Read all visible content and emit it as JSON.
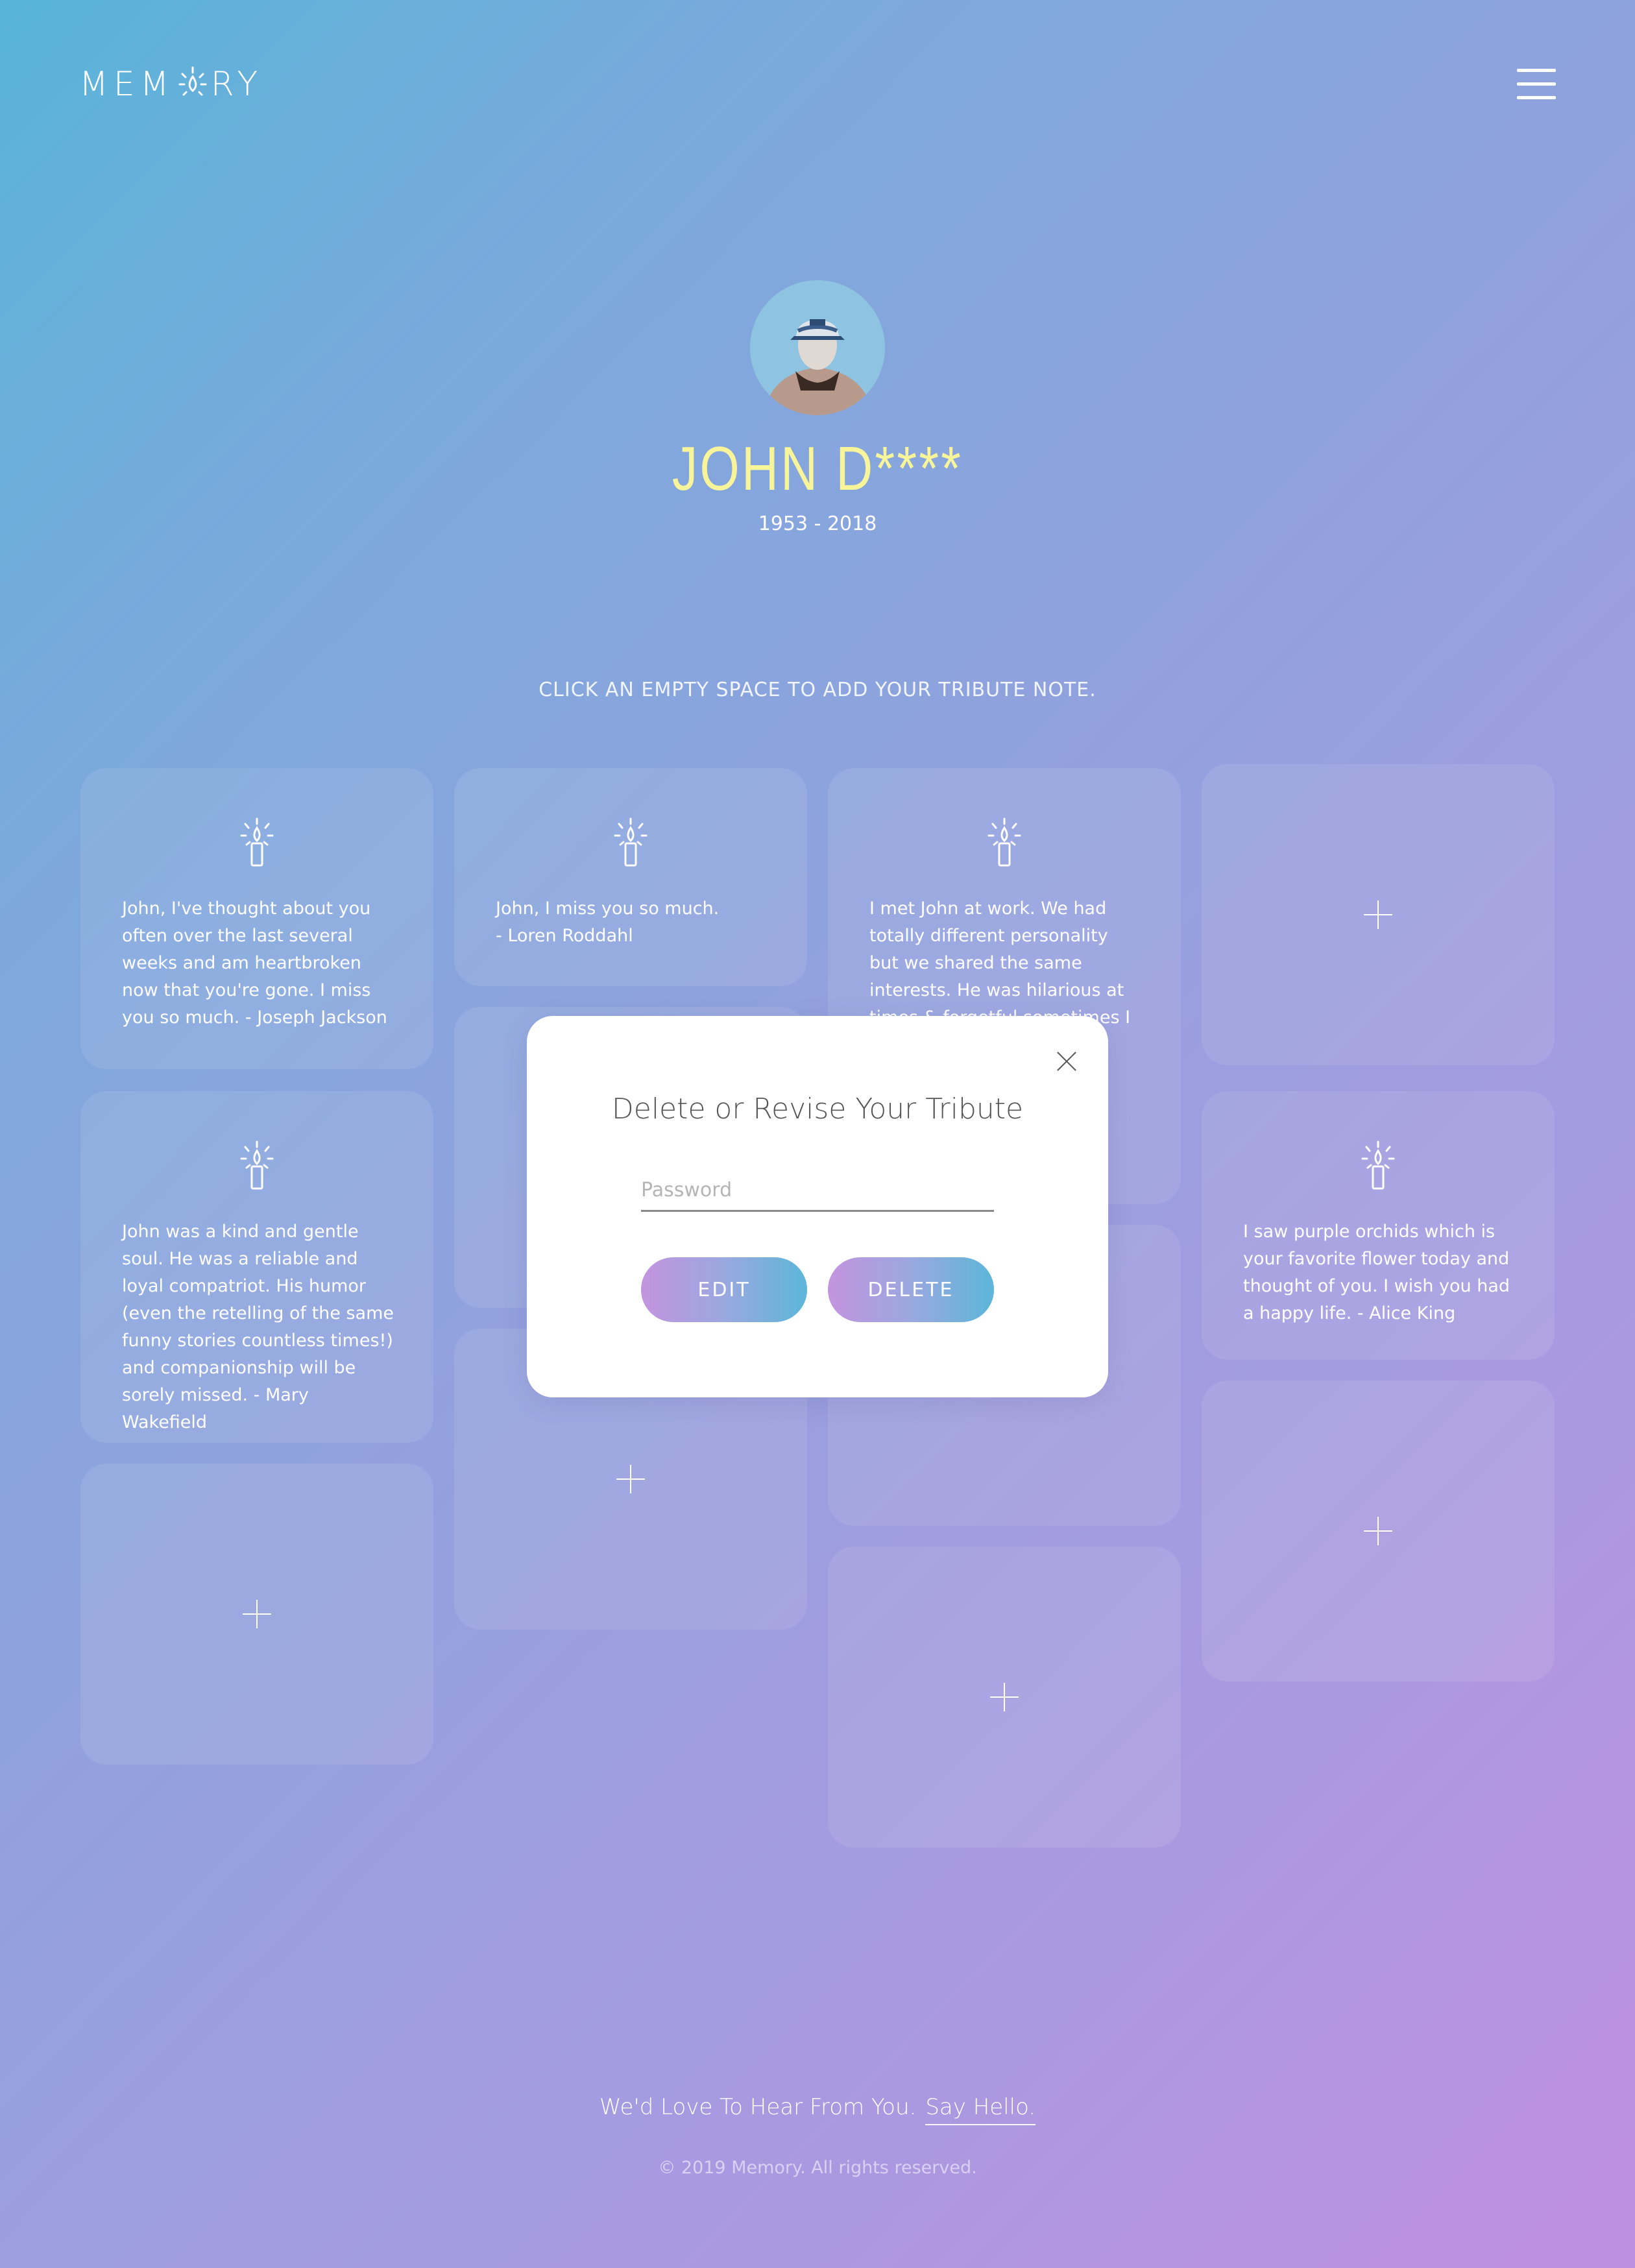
{
  "header": {
    "logo_left": "MEM",
    "logo_right": "RY",
    "menu_icon": "hamburger-menu-icon"
  },
  "profile": {
    "name": "JOHN D****",
    "years": "1953 - 2018"
  },
  "instruction": "CLICK AN EMPTY SPACE TO ADD YOUR TRIBUTE NOTE.",
  "tributes": [
    {
      "text": "John, I've thought about you often over the last several weeks and am heartbroken now that you're gone. I miss you so much. - Joseph Jackson"
    },
    {
      "text": "John, I miss you so much.\n- Loren Roddahl"
    },
    {
      "text": "I met John at work. We had totally different personality but we shared the same interests. He was hilarious at times & forgetful sometimes I have fond memories with John."
    },
    {
      "text": "John was a kind and gentle soul. He was a reliable and loyal compatriot. His humor (even the retelling of the same funny stories countless times!) and companionship will be sorely missed.  - Mary Wakefield"
    },
    {
      "text": "I saw purple orchids which is your favorite flower today and thought of you. I wish you had a happy life. - Alice King"
    }
  ],
  "modal": {
    "title": "Delete or Revise Your Tribute",
    "password_placeholder": "Password",
    "password_value": "",
    "edit_label": "EDIT",
    "delete_label": "DELETE",
    "close_icon": "close-icon"
  },
  "footer": {
    "message": "We'd Love To Hear From You.",
    "link": "Say Hello.",
    "copyright": "© 2019 Memory. All rights reserved."
  },
  "colors": {
    "gradient_start": "#58b4d9",
    "gradient_end": "#c090e0",
    "name_color": "#f7f49a",
    "button_gradient": [
      "#c394e0",
      "#5cb6d8"
    ]
  }
}
